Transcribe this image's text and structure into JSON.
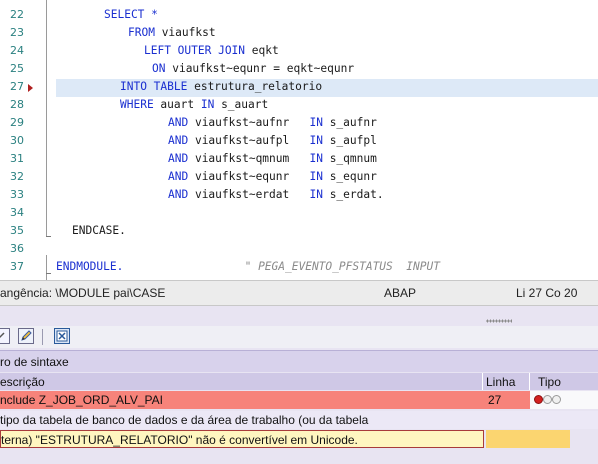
{
  "editor": {
    "lines": [
      {
        "num": "22",
        "parts": [
          {
            "t": "SELECT *",
            "k": "kw"
          }
        ]
      },
      {
        "num": "23",
        "parts": [
          {
            "t": "FROM ",
            "k": "kw"
          },
          {
            "t": "viaufkst",
            "k": ""
          }
        ]
      },
      {
        "num": "24",
        "parts": [
          {
            "t": "LEFT OUTER JOIN ",
            "k": "kw"
          },
          {
            "t": "eqkt",
            "k": ""
          }
        ]
      },
      {
        "num": "25",
        "parts": [
          {
            "t": "ON ",
            "k": "kw"
          },
          {
            "t": "viaufkst~equnr = eqkt~equnr",
            "k": ""
          }
        ]
      },
      {
        "num": "27",
        "parts": [
          {
            "t": "INTO TABLE ",
            "k": "kw"
          },
          {
            "t": "estrutura_relatorio",
            "k": ""
          }
        ]
      },
      {
        "num": "28",
        "parts": [
          {
            "t": "WHERE ",
            "k": "kw"
          },
          {
            "t": "auart ",
            "k": ""
          },
          {
            "t": "IN ",
            "k": "kw"
          },
          {
            "t": "s_auart",
            "k": ""
          }
        ]
      },
      {
        "num": "29",
        "parts": [
          {
            "t": "AND ",
            "k": "kw"
          },
          {
            "t": "viaufkst~aufnr   ",
            "k": ""
          },
          {
            "t": "IN ",
            "k": "kw"
          },
          {
            "t": "s_aufnr",
            "k": ""
          }
        ]
      },
      {
        "num": "30",
        "parts": [
          {
            "t": "AND ",
            "k": "kw"
          },
          {
            "t": "viaufkst~aufpl   ",
            "k": ""
          },
          {
            "t": "IN ",
            "k": "kw"
          },
          {
            "t": "s_aufpl",
            "k": ""
          }
        ]
      },
      {
        "num": "31",
        "parts": [
          {
            "t": "AND ",
            "k": "kw"
          },
          {
            "t": "viaufkst~qmnum   ",
            "k": ""
          },
          {
            "t": "IN ",
            "k": "kw"
          },
          {
            "t": "s_qmnum",
            "k": ""
          }
        ]
      },
      {
        "num": "32",
        "parts": [
          {
            "t": "AND ",
            "k": "kw"
          },
          {
            "t": "viaufkst~equnr   ",
            "k": ""
          },
          {
            "t": "IN ",
            "k": "kw"
          },
          {
            "t": "s_equnr",
            "k": ""
          }
        ]
      },
      {
        "num": "33",
        "parts": [
          {
            "t": "AND ",
            "k": "kw"
          },
          {
            "t": "viaufkst~erdat   ",
            "k": ""
          },
          {
            "t": "IN ",
            "k": "kw"
          },
          {
            "t": "s_erdat.",
            "k": ""
          }
        ]
      },
      {
        "num": "34",
        "parts": []
      },
      {
        "num": "35",
        "parts": [
          {
            "t": "ENDCASE.",
            "k": ""
          }
        ]
      },
      {
        "num": "36",
        "parts": []
      },
      {
        "num": "37",
        "parts": [
          {
            "t": "ENDMODULE.",
            "k": "kw"
          },
          {
            "t": "                  \" PEGA_EVENTO_PFSTATUS  INPUT",
            "k": "cmt"
          }
        ]
      }
    ]
  },
  "status_bar": {
    "context": "angência: \\MODULE pai\\CASE",
    "language": "ABAP",
    "position": "Li  27 Co  20"
  },
  "message_panel": {
    "toolbar": {
      "edit_icon": "pencil-icon",
      "toggle_icon": "checkbox-x-icon"
    },
    "title": "ro de sintaxe",
    "columns": {
      "description": "escrição",
      "line": "Linha",
      "type": "Tipo"
    },
    "error_row": {
      "description": "nclude Z_JOB_ORD_ALV_PAI",
      "line": "27",
      "type_icon": "error-traffic-light-icon"
    },
    "detail_lines": [
      " tipo da tabela de banco de dados e da área de trabalho (ou da tabela",
      "terna) \"ESTRUTURA_RELATORIO\" não é convertível em Unicode."
    ],
    "colors": {
      "error_row": "#f7837a",
      "highlight": "#fff6c0",
      "panel": "#e8e4f2",
      "keyword": "#1a2fd0",
      "line_number": "#2a8080"
    }
  }
}
